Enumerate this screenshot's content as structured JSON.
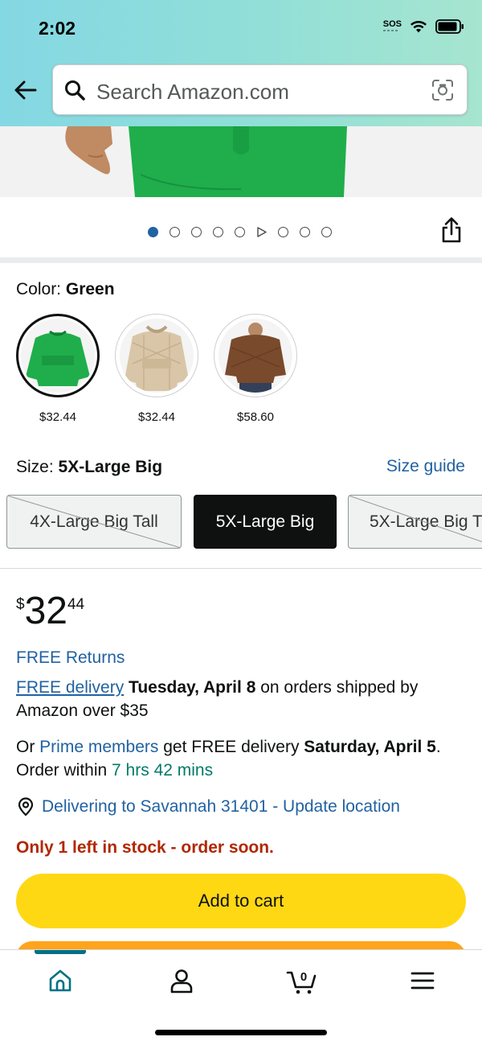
{
  "status_bar": {
    "time": "2:02",
    "sos": "SOS"
  },
  "search": {
    "placeholder": "Search Amazon.com"
  },
  "color": {
    "label": "Color: ",
    "selected": "Green",
    "swatches": [
      {
        "name": "Green",
        "price": "$32.44",
        "color": "#1fae4b"
      },
      {
        "name": "Beige",
        "price": "$32.44",
        "color": "#d9c6a8"
      },
      {
        "name": "Brown",
        "price": "$58.60",
        "color": "#7a4a2c"
      }
    ]
  },
  "carousel": {
    "image_count": 9,
    "active_index": 0,
    "video_index": 5
  },
  "size": {
    "label": "Size: ",
    "selected": "5X-Large Big",
    "guide_link": "Size guide",
    "options": [
      "4X-Large Big Tall",
      "5X-Large Big",
      "5X-Large Big T"
    ]
  },
  "price": {
    "symbol": "$",
    "whole": "32",
    "fraction": "44"
  },
  "returns": "FREE Returns",
  "delivery": {
    "link": "FREE delivery",
    "date": "Tuesday, April 8",
    "suffix": " on orders shipped by Amazon over $35"
  },
  "prime": {
    "prefix": "Or ",
    "link": "Prime members",
    "mid": " get FREE delivery ",
    "date": "Saturday, April 5",
    "end": ". Order within ",
    "countdown": "7 hrs 42 mins"
  },
  "location": "Delivering to Savannah 31401 - Update location",
  "stock": "Only 1 left in stock - order soon.",
  "add_to_cart": "Add to cart",
  "cart_count": "0",
  "colors": {
    "link": "#2162a1",
    "stock": "#b12704",
    "cart_button": "#ffd814",
    "buy_button": "#ffa41c",
    "accent": "#007185"
  }
}
